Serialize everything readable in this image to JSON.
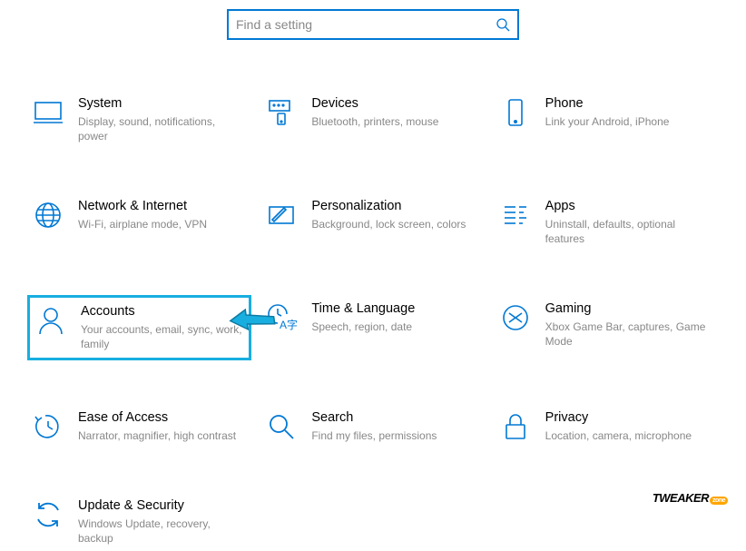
{
  "search": {
    "placeholder": "Find a setting"
  },
  "categories": [
    {
      "key": "system",
      "title": "System",
      "desc": "Display, sound, notifications, power"
    },
    {
      "key": "devices",
      "title": "Devices",
      "desc": "Bluetooth, printers, mouse"
    },
    {
      "key": "phone",
      "title": "Phone",
      "desc": "Link your Android, iPhone"
    },
    {
      "key": "network",
      "title": "Network & Internet",
      "desc": "Wi-Fi, airplane mode, VPN"
    },
    {
      "key": "personalization",
      "title": "Personalization",
      "desc": "Background, lock screen, colors"
    },
    {
      "key": "apps",
      "title": "Apps",
      "desc": "Uninstall, defaults, optional features"
    },
    {
      "key": "accounts",
      "title": "Accounts",
      "desc": "Your accounts, email, sync, work, family",
      "highlighted": true
    },
    {
      "key": "time",
      "title": "Time & Language",
      "desc": "Speech, region, date"
    },
    {
      "key": "gaming",
      "title": "Gaming",
      "desc": "Xbox Game Bar, captures, Game Mode"
    },
    {
      "key": "ease",
      "title": "Ease of Access",
      "desc": "Narrator, magnifier, high contrast"
    },
    {
      "key": "search",
      "title": "Search",
      "desc": "Find my files, permissions"
    },
    {
      "key": "privacy",
      "title": "Privacy",
      "desc": "Location, camera, microphone"
    },
    {
      "key": "update",
      "title": "Update & Security",
      "desc": "Windows Update, recovery, backup"
    }
  ],
  "watermark": {
    "main": "TWEAKER",
    "zone": "zone"
  }
}
